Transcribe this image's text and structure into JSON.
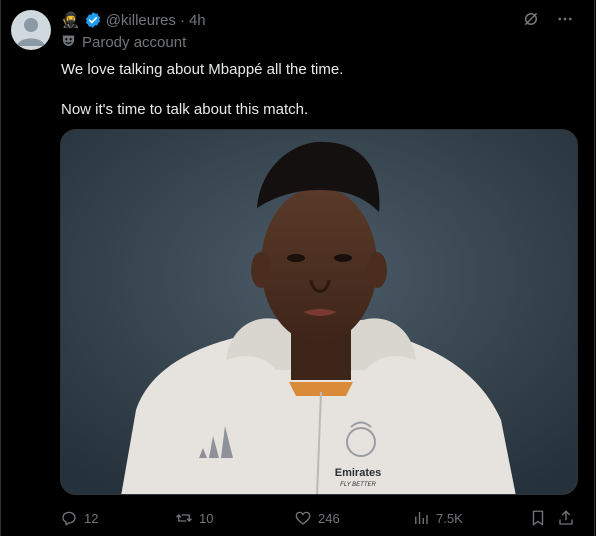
{
  "tweet": {
    "display_name": "🥷",
    "handle": "@killeures",
    "separator": "·",
    "time": "4h",
    "parody_label": "Parody account",
    "lines": [
      "We love talking about Mbappé all the time.",
      "Now it's time to talk about this match."
    ],
    "media": {
      "jersey_sponsor": "Emirates",
      "jersey_sponsor_sub": "FLY BETTER"
    }
  },
  "actions": {
    "replies": "12",
    "reposts": "10",
    "likes": "246",
    "views": "7.5K"
  },
  "colors": {
    "background": "#000000",
    "text": "#e7e9ea",
    "muted": "#71767b",
    "verified": "#1d9bf0",
    "divider": "#2f3336"
  }
}
